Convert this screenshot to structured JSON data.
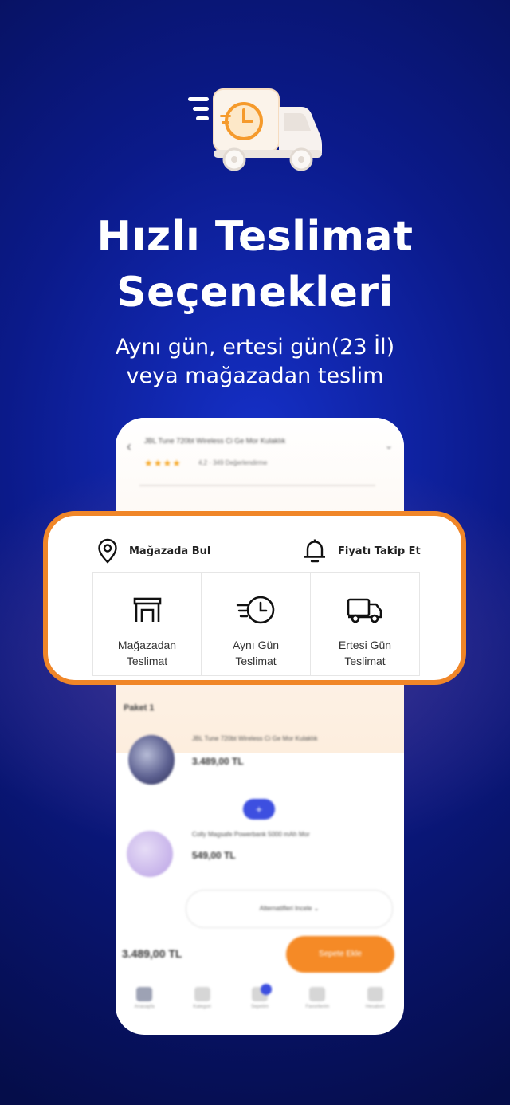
{
  "hero": {
    "icon": "delivery-truck-clock-icon",
    "title_line1": "Hızlı Teslimat",
    "title_line2": "Seçenekleri",
    "subtitle_line1": "Aynı gün, ertesi gün(23 İl)",
    "subtitle_line2": "veya mağazadan teslim"
  },
  "card": {
    "store_find_label": "Mağazada Bul",
    "price_track_label": "Fiyatı Takip Et",
    "options": [
      {
        "line1": "Mağazadan",
        "line2": "Teslimat",
        "icon": "store-icon"
      },
      {
        "line1": "Aynı Gün",
        "line2": "Teslimat",
        "icon": "fast-clock-icon"
      },
      {
        "line1": "Ertesi Gün",
        "line2": "Teslimat",
        "icon": "truck-icon"
      }
    ]
  },
  "phone": {
    "product_title": "JBL Tune 720bt Wireless Ci Ge Mor Kulaklık",
    "stars": "★★★★",
    "rating_text": "4,2 · 349 Değerlendirme",
    "package_label": "Paket 1",
    "product1_name": "JBL Tune 720bt Wireless Ci Ge Mor Kulaklık",
    "product1_price": "3.489,00 TL",
    "plus": "+",
    "product2_name": "Colly Magsafe Powerbank 5000 mAh Mor",
    "product2_price": "549,00 TL",
    "alternatives_label": "Alternatifleri Incele ⌄",
    "total": "3.489,00 TL",
    "buy_label": "Sepete Ekle",
    "nav": [
      "Anasayfa",
      "Kategori",
      "Sepetim",
      "Favorilerim",
      "Hesabım"
    ]
  },
  "colors": {
    "accent_orange": "#f08628",
    "background_blue": "#0b1a8a",
    "badge_blue": "#3d4fe0"
  }
}
